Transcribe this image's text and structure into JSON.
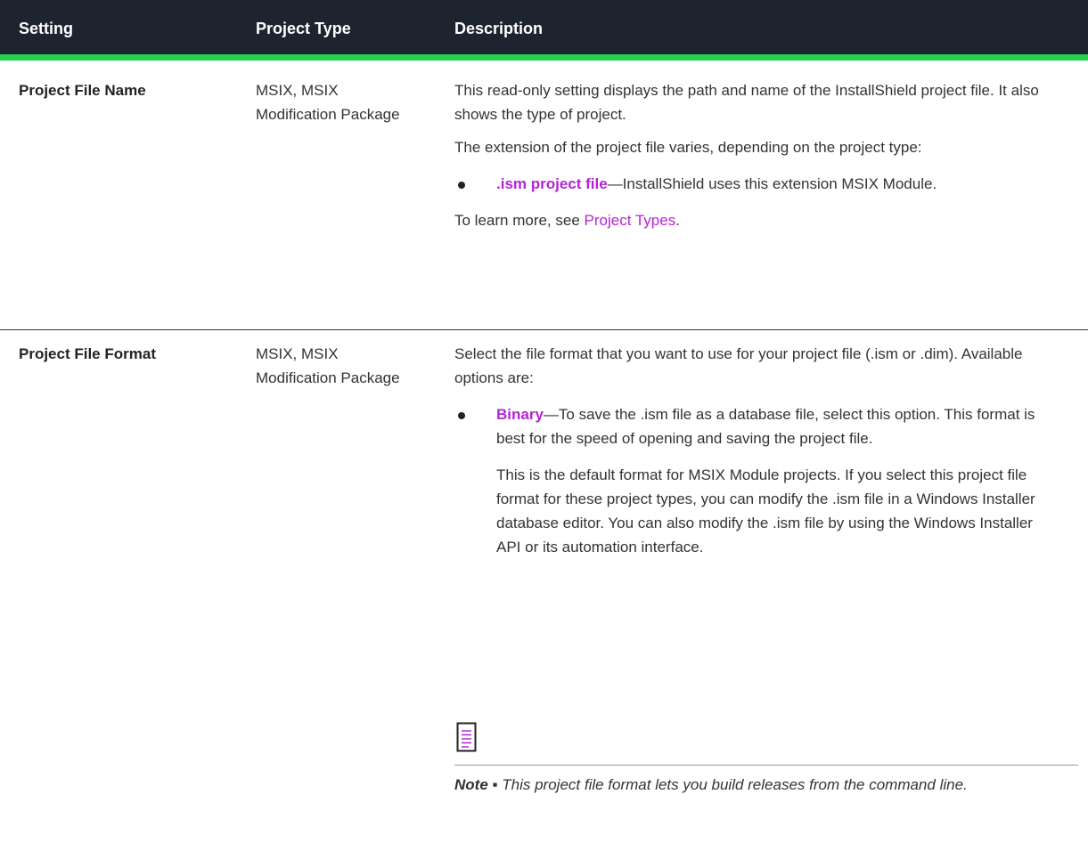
{
  "table": {
    "headers": [
      "Setting",
      "Project Type",
      "Description"
    ],
    "rows": [
      {
        "setting": "Project File Name",
        "project_type": "MSIX, MSIX Modification Package",
        "paragraph1": "This read-only setting displays the path and name of the InstallShield project file. It also shows the type of project.",
        "paragraph2": "The extension of the project file varies, depending on the project type:",
        "bullet_term": ".ism project file",
        "bullet_text": "—InstallShield uses this extension MSIX Module.",
        "learn_more_prefix": "To learn more, see ",
        "learn_more_link": "Project Types",
        "learn_more_suffix": "."
      },
      {
        "setting": "Project File Format",
        "project_type": "MSIX, MSIX Modification Package",
        "paragraph1": "Select the file format that you want to use for your project file (.ism or .dim). Available options are:",
        "bullet_term": "Binary",
        "bullet_text": "—To save the .ism file as a database file, select this option. This format is best for the speed of opening and saving the project file.",
        "bullet_paragraph": "This is the default format for MSIX Module projects. If you select this project file format for these project types, you can modify the .ism file in a Windows Installer database editor. You can also modify the .ism file by using the Windows Installer API or its automation interface.",
        "note_label": "Note ▪",
        "note_text": " This project file format lets you build releases from the command line."
      }
    ]
  },
  "colors": {
    "header_bg": "#1e2330",
    "header_accent": "#22d34a",
    "link": "#b325d3"
  },
  "icons": {
    "note": "note-icon"
  }
}
